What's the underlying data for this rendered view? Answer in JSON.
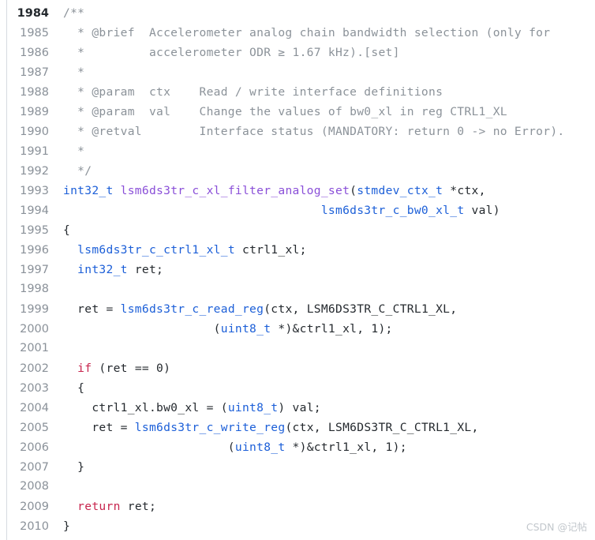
{
  "viewer": {
    "name": "code-snippet-viewer",
    "background": "#ffffff",
    "gutter_rule_color": "#d6dbe0",
    "active_line_number": "1984"
  },
  "colors": {
    "comment": "#8b9299",
    "type": "#1c5fd8",
    "keyword": "#c7254e",
    "function_definition": "#8a4fd8",
    "function_call": "#1c5fd8",
    "plain_text": "#24292e",
    "line_number": "#8a9199",
    "line_number_active": "#24292e",
    "watermark": "#c2c7cc"
  },
  "watermark": {
    "text": "CSDN @记帖"
  },
  "lines": [
    {
      "number": "1984",
      "active": true,
      "tokens": [
        {
          "t": "/**",
          "c": "comment"
        }
      ]
    },
    {
      "number": "1985",
      "active": false,
      "tokens": [
        {
          "t": "  * @brief  Accelerometer analog chain bandwidth selection (only for",
          "c": "comment"
        }
      ]
    },
    {
      "number": "1986",
      "active": false,
      "tokens": [
        {
          "t": "  *         accelerometer ODR ≥ 1.67 kHz).[set]",
          "c": "comment"
        }
      ]
    },
    {
      "number": "1987",
      "active": false,
      "tokens": [
        {
          "t": "  *",
          "c": "comment"
        }
      ]
    },
    {
      "number": "1988",
      "active": false,
      "tokens": [
        {
          "t": "  * @param  ctx    Read / write interface definitions",
          "c": "comment"
        }
      ]
    },
    {
      "number": "1989",
      "active": false,
      "tokens": [
        {
          "t": "  * @param  val    Change the values of bw0_xl in reg CTRL1_XL",
          "c": "comment"
        }
      ]
    },
    {
      "number": "1990",
      "active": false,
      "tokens": [
        {
          "t": "  * @retval        Interface status (MANDATORY: return 0 -> no Error).",
          "c": "comment"
        }
      ]
    },
    {
      "number": "1991",
      "active": false,
      "tokens": [
        {
          "t": "  *",
          "c": "comment"
        }
      ]
    },
    {
      "number": "1992",
      "active": false,
      "tokens": [
        {
          "t": "  */",
          "c": "comment"
        }
      ]
    },
    {
      "number": "1993",
      "active": false,
      "tokens": [
        {
          "t": "int32_t ",
          "c": "type"
        },
        {
          "t": "lsm6ds3tr_c_xl_filter_analog_set",
          "c": "function_definition"
        },
        {
          "t": "(",
          "c": "plain"
        },
        {
          "t": "stmdev_ctx_t ",
          "c": "type"
        },
        {
          "t": "*ctx,",
          "c": "plain"
        }
      ]
    },
    {
      "number": "1994",
      "active": false,
      "tokens": [
        {
          "t": "                                    ",
          "c": "plain"
        },
        {
          "t": "lsm6ds3tr_c_bw0_xl_t ",
          "c": "type"
        },
        {
          "t": "val)",
          "c": "plain"
        }
      ]
    },
    {
      "number": "1995",
      "active": false,
      "tokens": [
        {
          "t": "{",
          "c": "plain"
        }
      ]
    },
    {
      "number": "1996",
      "active": false,
      "tokens": [
        {
          "t": "  ",
          "c": "plain"
        },
        {
          "t": "lsm6ds3tr_c_ctrl1_xl_t",
          "c": "type"
        },
        {
          "t": " ctrl1_xl;",
          "c": "plain"
        }
      ]
    },
    {
      "number": "1997",
      "active": false,
      "tokens": [
        {
          "t": "  ",
          "c": "plain"
        },
        {
          "t": "int32_t",
          "c": "type"
        },
        {
          "t": " ret;",
          "c": "plain"
        }
      ]
    },
    {
      "number": "1998",
      "active": false,
      "tokens": [
        {
          "t": "",
          "c": "plain"
        }
      ]
    },
    {
      "number": "1999",
      "active": false,
      "tokens": [
        {
          "t": "  ret = ",
          "c": "plain"
        },
        {
          "t": "lsm6ds3tr_c_read_reg",
          "c": "function_call"
        },
        {
          "t": "(ctx, LSM6DS3TR_C_CTRL1_XL,",
          "c": "plain"
        }
      ]
    },
    {
      "number": "2000",
      "active": false,
      "tokens": [
        {
          "t": "                     (",
          "c": "plain"
        },
        {
          "t": "uint8_t",
          "c": "type"
        },
        {
          "t": " *)&ctrl1_xl, 1);",
          "c": "plain"
        }
      ]
    },
    {
      "number": "2001",
      "active": false,
      "tokens": [
        {
          "t": "",
          "c": "plain"
        }
      ]
    },
    {
      "number": "2002",
      "active": false,
      "tokens": [
        {
          "t": "  ",
          "c": "plain"
        },
        {
          "t": "if",
          "c": "keyword"
        },
        {
          "t": " (ret == 0)",
          "c": "plain"
        }
      ]
    },
    {
      "number": "2003",
      "active": false,
      "tokens": [
        {
          "t": "  {",
          "c": "plain"
        }
      ]
    },
    {
      "number": "2004",
      "active": false,
      "tokens": [
        {
          "t": "    ctrl1_xl.bw0_xl = (",
          "c": "plain"
        },
        {
          "t": "uint8_t",
          "c": "type"
        },
        {
          "t": ") val;",
          "c": "plain"
        }
      ]
    },
    {
      "number": "2005",
      "active": false,
      "tokens": [
        {
          "t": "    ret = ",
          "c": "plain"
        },
        {
          "t": "lsm6ds3tr_c_write_reg",
          "c": "function_call"
        },
        {
          "t": "(ctx, LSM6DS3TR_C_CTRL1_XL,",
          "c": "plain"
        }
      ]
    },
    {
      "number": "2006",
      "active": false,
      "tokens": [
        {
          "t": "                       (",
          "c": "plain"
        },
        {
          "t": "uint8_t",
          "c": "type"
        },
        {
          "t": " *)&ctrl1_xl, 1);",
          "c": "plain"
        }
      ]
    },
    {
      "number": "2007",
      "active": false,
      "tokens": [
        {
          "t": "  }",
          "c": "plain"
        }
      ]
    },
    {
      "number": "2008",
      "active": false,
      "tokens": [
        {
          "t": "",
          "c": "plain"
        }
      ]
    },
    {
      "number": "2009",
      "active": false,
      "tokens": [
        {
          "t": "  ",
          "c": "plain"
        },
        {
          "t": "return",
          "c": "keyword"
        },
        {
          "t": " ret;",
          "c": "plain"
        }
      ]
    },
    {
      "number": "2010",
      "active": false,
      "tokens": [
        {
          "t": "}",
          "c": "plain"
        }
      ]
    }
  ]
}
